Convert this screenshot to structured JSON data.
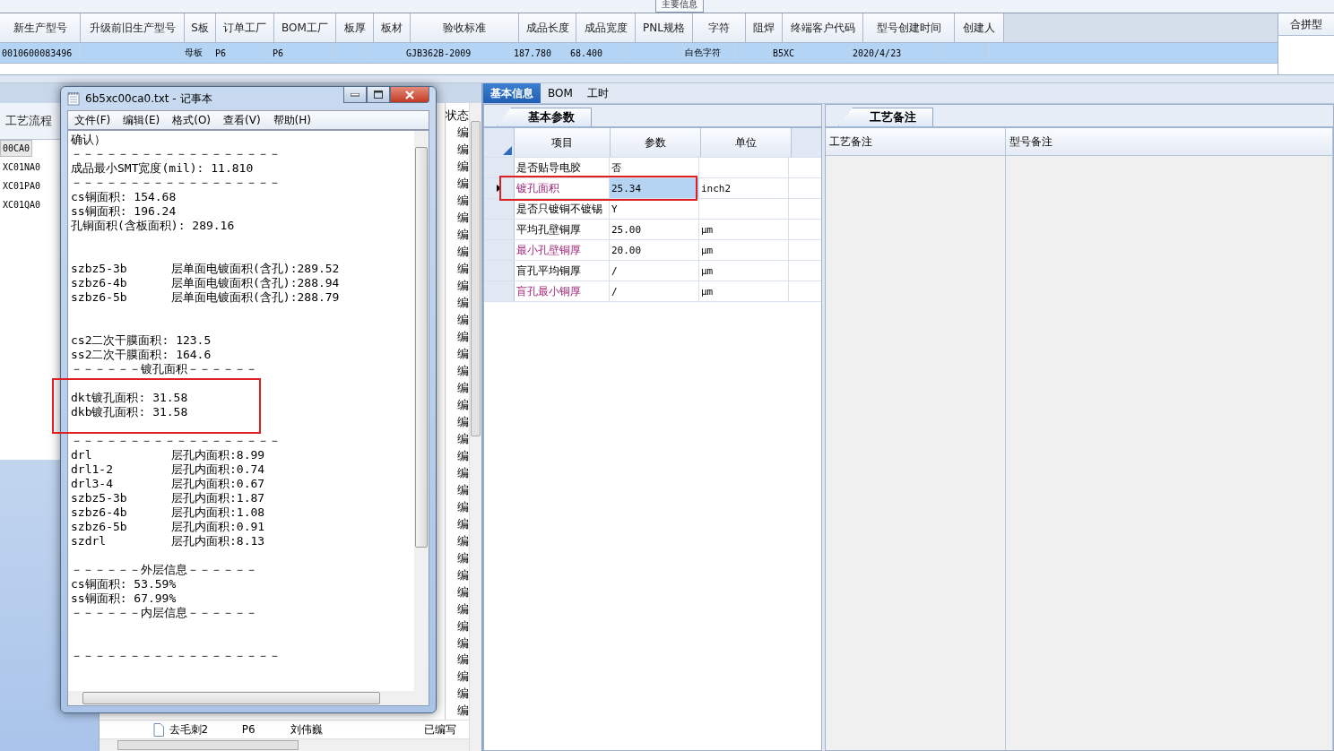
{
  "top_tab": {
    "label": "主要信息"
  },
  "product_table": {
    "columns": [
      "新生产型号",
      "升级前旧生产型号",
      "S板",
      "订单工厂",
      "BOM工厂",
      "板厚",
      "板材",
      "验收标准",
      "成品长度",
      "成品宽度",
      "PNL规格",
      "字符",
      "阻焊",
      "终端客户代码",
      "型号创建时间",
      "创建人"
    ],
    "rows": [
      {
        "selected": true,
        "cells": [
          "0010600083496",
          "",
          "母板",
          "P6",
          "P6",
          "",
          "",
          "GJB362B-2009",
          "187.780",
          "68.400",
          "",
          "白色字符",
          "",
          "B5XC",
          "2020/4/23",
          ""
        ]
      }
    ],
    "side_column": "合拼型"
  },
  "process_panel": {
    "title": "工艺流程",
    "items": [
      {
        "label": "00CA0",
        "selected": true
      },
      {
        "label": "XC01NA0",
        "selected": false
      },
      {
        "label": "XC01PA0",
        "selected": false
      },
      {
        "label": "XC01QA0",
        "selected": false
      }
    ]
  },
  "status_column": {
    "header": "状态",
    "cells": [
      "编",
      "编",
      "编",
      "编",
      "编",
      "编",
      "编",
      "编",
      "编",
      "编",
      "编",
      "编",
      "编",
      "编",
      "编",
      "编",
      "编",
      "编",
      "编",
      "编",
      "编",
      "编",
      "编",
      "编",
      "编",
      "编",
      "编",
      "编",
      "编",
      "编",
      "编",
      "编",
      "编",
      "编",
      "编"
    ]
  },
  "tree_row": {
    "name": "去毛刺2",
    "factory": "P6",
    "person": "刘伟巍",
    "status": "已编写"
  },
  "notepad": {
    "title": "6b5xc00ca0.txt - 记事本",
    "menu": [
      "文件(F)",
      "编辑(E)",
      "格式(O)",
      "查看(V)",
      "帮助(H)"
    ],
    "lines": [
      {
        "kind": "text",
        "text": "确认）"
      },
      {
        "kind": "text",
        "text": "－－－－－－－－－－－－－－－－－－"
      },
      {
        "kind": "text",
        "text": "成品最小SMT宽度(mil): 11.810"
      },
      {
        "kind": "text",
        "text": "－－－－－－－－－－－－－－－－－－"
      },
      {
        "kind": "text",
        "text": "cs铜面积: 154.68"
      },
      {
        "kind": "text",
        "text": "ss铜面积: 196.24"
      },
      {
        "kind": "text",
        "text": "孔铜面积(含板面积): 289.16"
      },
      {
        "kind": "blank"
      },
      {
        "kind": "blank"
      },
      {
        "kind": "pair",
        "left": "szbz5-3b",
        "right": "层单面电镀面积(含孔):289.52"
      },
      {
        "kind": "pair",
        "left": "szbz6-4b",
        "right": "层单面电镀面积(含孔):288.94"
      },
      {
        "kind": "pair",
        "left": "szbz6-5b",
        "right": "层单面电镀面积(含孔):288.79"
      },
      {
        "kind": "blank"
      },
      {
        "kind": "blank"
      },
      {
        "kind": "text",
        "text": "cs2二次干膜面积: 123.5"
      },
      {
        "kind": "text",
        "text": "ss2二次干膜面积: 164.6"
      },
      {
        "kind": "text",
        "text": "－－－－－－镀孔面积－－－－－－"
      },
      {
        "kind": "blank"
      },
      {
        "kind": "text",
        "text": "dkt镀孔面积: 31.58"
      },
      {
        "kind": "text",
        "text": "dkb镀孔面积: 31.58"
      },
      {
        "kind": "blank"
      },
      {
        "kind": "text",
        "text": "－－－－－－－－－－－－－－－－－－"
      },
      {
        "kind": "pair",
        "left": "drl",
        "right": "层孔内面积:8.99"
      },
      {
        "kind": "pair",
        "left": "drl1-2",
        "right": "层孔内面积:0.74"
      },
      {
        "kind": "pair",
        "left": "drl3-4",
        "right": "层孔内面积:0.67"
      },
      {
        "kind": "pair",
        "left": "szbz5-3b",
        "right": "层孔内面积:1.87"
      },
      {
        "kind": "pair",
        "left": "szbz6-4b",
        "right": "层孔内面积:1.08"
      },
      {
        "kind": "pair",
        "left": "szbz6-5b",
        "right": "层孔内面积:0.91"
      },
      {
        "kind": "pair",
        "left": "szdrl",
        "right": "层孔内面积:8.13"
      },
      {
        "kind": "blank"
      },
      {
        "kind": "text",
        "text": "－－－－－－外层信息－－－－－－"
      },
      {
        "kind": "text",
        "text": "cs铜面积: 53.59%"
      },
      {
        "kind": "text",
        "text": "ss铜面积: 67.99%"
      },
      {
        "kind": "text",
        "text": "－－－－－－内层信息－－－－－－"
      },
      {
        "kind": "blank"
      },
      {
        "kind": "blank"
      },
      {
        "kind": "text",
        "text": "－－－－－－－－－－－－－－－－－－"
      }
    ]
  },
  "detail_tabs": [
    {
      "label": "基本信息",
      "selected": true
    },
    {
      "label": "BOM",
      "selected": false
    },
    {
      "label": "工时",
      "selected": false
    }
  ],
  "params": {
    "tab": "基本参数",
    "columns": [
      "项目",
      "参数",
      "单位"
    ],
    "rows": [
      {
        "item": "是否贴导电胶",
        "value": "否",
        "unit": "",
        "emphasized": false,
        "selected": false
      },
      {
        "item": "镀孔面积",
        "value": "25.34",
        "unit": "inch2",
        "emphasized": true,
        "selected": true
      },
      {
        "item": "是否只镀铜不镀锡",
        "value": "Y",
        "unit": "",
        "emphasized": false,
        "selected": false
      },
      {
        "item": "平均孔壁铜厚",
        "value": "25.00",
        "unit": "μm",
        "emphasized": false,
        "selected": false
      },
      {
        "item": "最小孔壁铜厚",
        "value": "20.00",
        "unit": "μm",
        "emphasized": true,
        "selected": false
      },
      {
        "item": "盲孔平均铜厚",
        "value": "/",
        "unit": "μm",
        "emphasized": false,
        "selected": false
      },
      {
        "item": "盲孔最小铜厚",
        "value": "/",
        "unit": "μm",
        "emphasized": true,
        "selected": false
      }
    ]
  },
  "notes": {
    "tab": "工艺备注",
    "columns": [
      "工艺备注",
      "型号备注"
    ]
  }
}
